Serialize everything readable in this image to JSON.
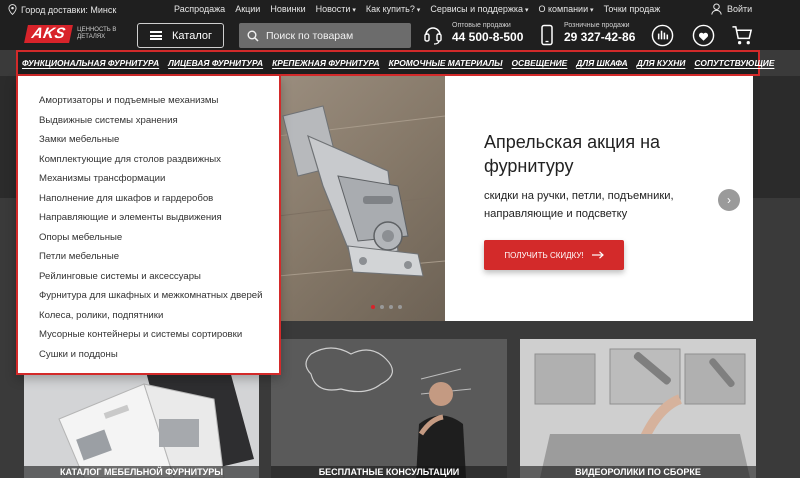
{
  "topbar": {
    "city_label": "Город доставки: Минск",
    "nav": [
      "Распродажа",
      "Акции",
      "Новинки",
      "Новости",
      "Как купить?",
      "Сервисы и поддержка",
      "О компании",
      "Точки продаж"
    ],
    "nav_dropdown": [
      false,
      false,
      false,
      true,
      true,
      true,
      true,
      false
    ],
    "login": "Войти"
  },
  "header": {
    "logo": "AKS",
    "logo_tagline": "ЦЕННОСТЬ В ДЕТАЛЯХ",
    "catalog_label": "Каталог",
    "search_placeholder": "Поиск по товарам",
    "wholesale": {
      "label": "Оптовые продажи",
      "number": "44 500-8-500"
    },
    "retail": {
      "label": "Розничные продажи",
      "number": "29 327-42-86"
    },
    "icons": [
      "compare-icon",
      "favorites-icon",
      "cart-icon"
    ]
  },
  "categories": [
    "Функциональная фурнитура",
    "Лицевая фурнитура",
    "Крепежная фурнитура",
    "Кромочные материалы",
    "Освещение",
    "Для шкафа",
    "Для кухни",
    "Сопутствующие"
  ],
  "dropdown_items": [
    "Амортизаторы и подъемные механизмы",
    "Выдвижные системы хранения",
    "Замки мебельные",
    "Комплектующие для столов раздвижных",
    "Механизмы трансформации",
    "Наполнение для шкафов и гардеробов",
    "Направляющие и элементы выдвижения",
    "Опоры мебельные",
    "Петли мебельные",
    "Рейлинговые системы и аксессуары",
    "Фурнитура для шкафных и межкомнатных дверей",
    "Колеса, ролики, подпятники",
    "Мусорные контейнеры и системы сортировки",
    "Сушки и поддоны"
  ],
  "hero": {
    "title": "Апрельская акция на фурнитуру",
    "subtitle": "скидки на ручки, петли, подъемники, направляющие и подсветку",
    "button": "ПОЛУЧИТЬ СКИДКУ!",
    "slide_count": 4,
    "active_slide": 1
  },
  "cards": [
    {
      "caption": "КАТАЛОГ МЕБЕЛЬНОЙ ФУРНИТУРЫ"
    },
    {
      "caption": "БЕСПЛАТНЫЕ КОНСУЛЬТАЦИИ"
    },
    {
      "caption": "ВИДЕОРОЛИКИ ПО СБОРКЕ"
    }
  ],
  "colors": {
    "brand_red": "#d8232a",
    "dark_bg": "#1f1f1f",
    "highlight_border": "#d32a2a"
  }
}
